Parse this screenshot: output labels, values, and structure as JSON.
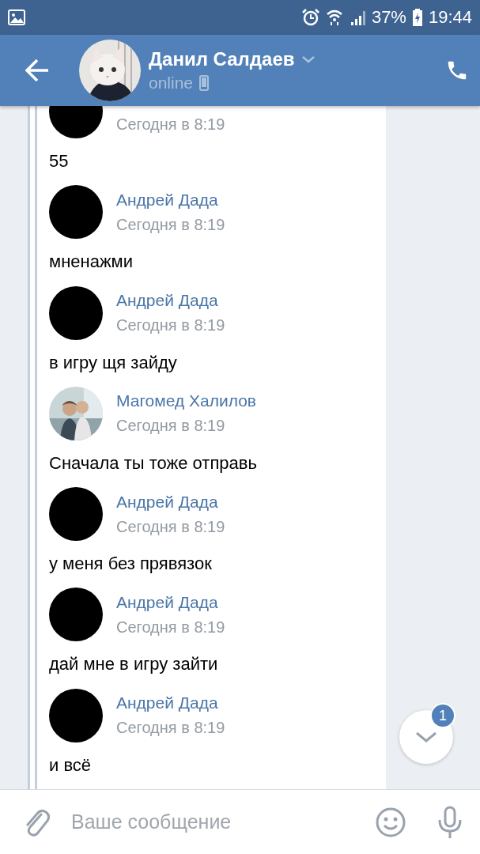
{
  "status_bar": {
    "battery": "37%",
    "time": "19:44"
  },
  "header": {
    "name": "Данил Салдаев",
    "status": "online"
  },
  "messages": [
    {
      "kind": "redacted",
      "time": "Сегодня в 8:19",
      "text": "55"
    },
    {
      "kind": "redacted",
      "name": "Андрей Дада",
      "time": "Сегодня в 8:19",
      "text": "мненажми"
    },
    {
      "kind": "redacted",
      "name": "Андрей Дада",
      "time": "Сегодня в 8:19",
      "text": "в игру щя зайду"
    },
    {
      "kind": "picture",
      "name": "Магомед Халилов",
      "time": "Сегодня в 8:19",
      "text": "Сначала ты тоже отправь"
    },
    {
      "kind": "redacted",
      "name": "Андрей Дада",
      "time": "Сегодня в 8:19",
      "text": "у меня без прявязок"
    },
    {
      "kind": "redacted",
      "name": "Андрей Дада",
      "time": "Сегодня в 8:19",
      "text": "дай мне в игру зайти"
    },
    {
      "kind": "redacted",
      "name": "Андрей Дада",
      "time": "Сегодня в 8:19",
      "text": "и всё"
    }
  ],
  "scroll_button": {
    "badge": "1"
  },
  "composer": {
    "placeholder": "Ваше сообщение"
  }
}
